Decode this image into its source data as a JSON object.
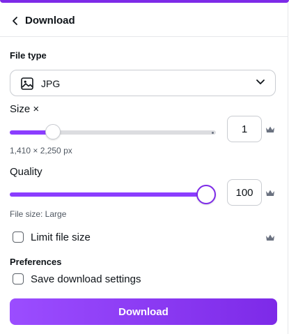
{
  "header": {
    "title": "Download"
  },
  "file_type": {
    "label": "File type",
    "selected": "JPG"
  },
  "size": {
    "label": "Size ×",
    "value": "1",
    "slider_level": 0.21,
    "dimensions": "1,410 × 2,250 px"
  },
  "quality": {
    "label": "Quality",
    "value": "100",
    "slider_level": 1.0,
    "hint": "File size: Large"
  },
  "limit_file_size": {
    "label": "Limit file size",
    "checked": false
  },
  "preferences": {
    "label": "Preferences",
    "save_settings_label": "Save download settings",
    "checked": false
  },
  "download_button": {
    "label": "Download"
  },
  "colors": {
    "accent": "#8b3dff",
    "accent_dark": "#7d2ae8",
    "premium": "#6b7280"
  },
  "icons": [
    "chevron-left-icon",
    "image-icon",
    "chevron-down-icon",
    "crown-icon"
  ]
}
